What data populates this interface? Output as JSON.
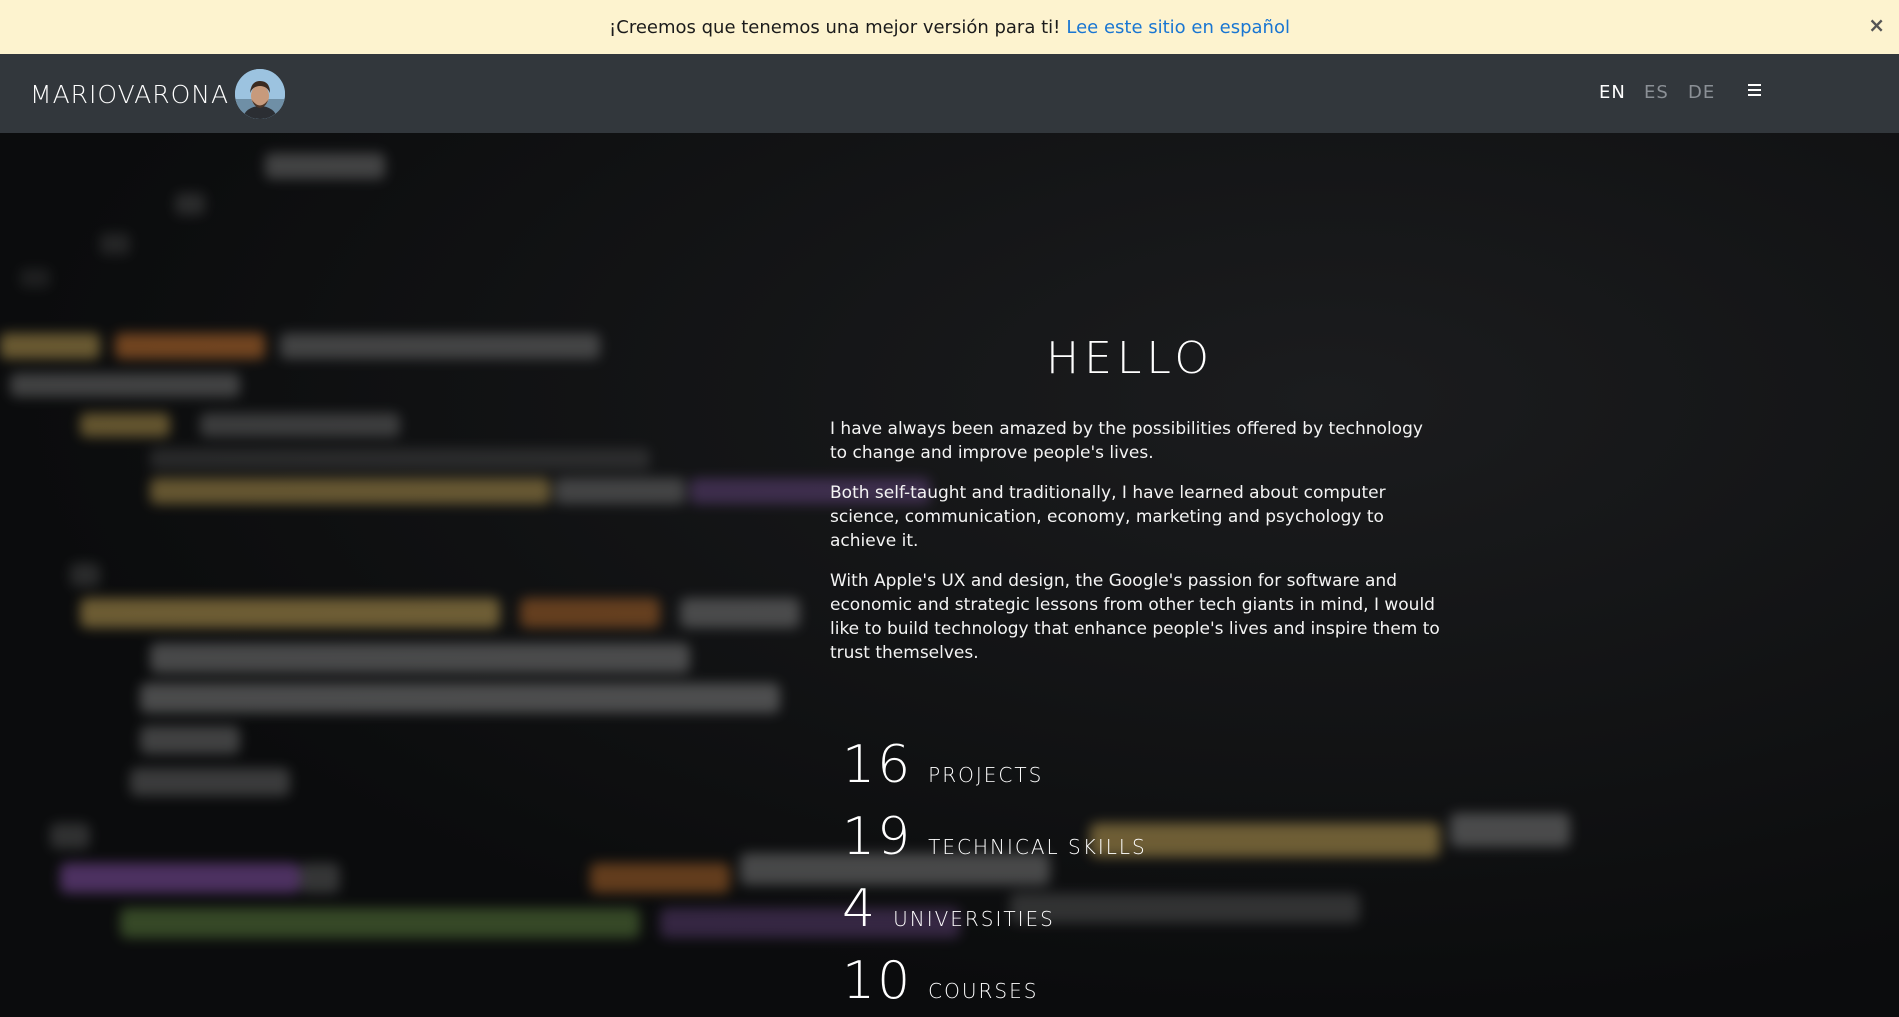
{
  "banner": {
    "message": "¡Creemos que tenemos una mejor versión para ti!",
    "link_text": "Lee este sitio en español",
    "close_symbol": "×"
  },
  "navbar": {
    "brand": "MARIOVARONA",
    "languages": [
      "EN",
      "ES",
      "DE"
    ],
    "active_language": "EN",
    "menu_icon": "hamburger-icon"
  },
  "hero": {
    "title": "HELLO",
    "paragraphs": [
      "I have always been amazed by the possibilities offered by technology to change and improve people's lives.",
      "Both self-taught and traditionally, I have learned about computer science, communication, economy, marketing and psychology to achieve it.",
      "With Apple's UX and design, the Google's passion for software and economic and strategic lessons from other tech giants in mind, I would like to build technology that enhance people's lives and inspire them to trust themselves."
    ],
    "stats": [
      {
        "number": "16",
        "label": "PROJECTS"
      },
      {
        "number": "19",
        "label": "TECHNICAL SKILLS"
      },
      {
        "number": "4",
        "label": "UNIVERSITIES"
      },
      {
        "number": "10",
        "label": "COURSES"
      }
    ]
  },
  "colors": {
    "banner_bg": "#fdf3cf",
    "link": "#1976d2",
    "navbar_bg": "#32373c",
    "hero_bg": "#0f1011"
  }
}
